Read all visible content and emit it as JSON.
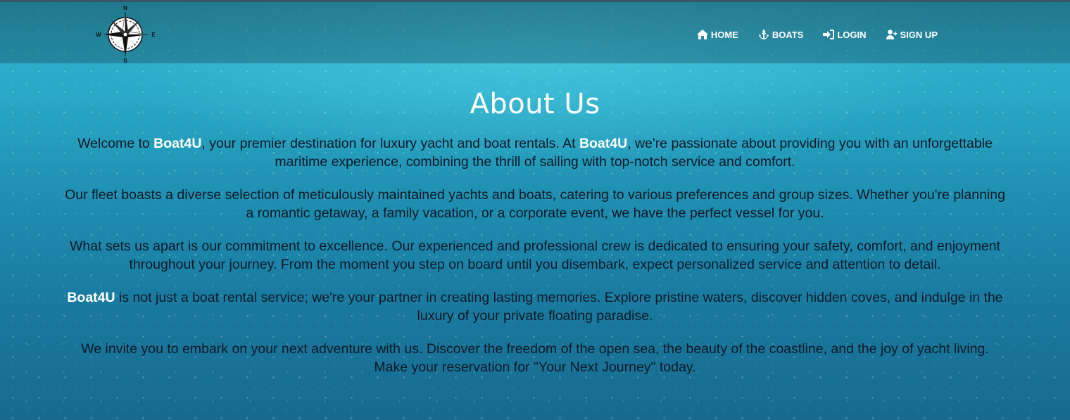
{
  "nav": {
    "logo": {
      "icon": "compass-rose-icon",
      "letters": [
        "N",
        "E",
        "S",
        "W"
      ]
    },
    "items": [
      {
        "label": "HOME",
        "icon": "home-icon"
      },
      {
        "label": "BOATS",
        "icon": "anchor-icon"
      },
      {
        "label": "LOGIN",
        "icon": "login-icon"
      },
      {
        "label": "SIGN UP",
        "icon": "user-plus-icon"
      }
    ]
  },
  "about": {
    "title": "About Us",
    "brand": "Boat4U",
    "p1": {
      "a": "Welcome to ",
      "b": ", your premier destination for luxury yacht and boat rentals. At ",
      "c": ", we're passionate about providing you with an unforgettable maritime experience, combining the thrill of sailing with top-notch service and comfort."
    },
    "p2": "Our fleet boasts a diverse selection of meticulously maintained yachts and boats, catering to various preferences and group sizes. Whether you're planning a romantic getaway, a family vacation, or a corporate event, we have the perfect vessel for you.",
    "p3": "What sets us apart is our commitment to excellence. Our experienced and professional crew is dedicated to ensuring your safety, comfort, and enjoyment throughout your journey. From the moment you step on board until you disembark, expect personalized service and attention to detail.",
    "p4": {
      "rest": " is not just a boat rental service; we're your partner in creating lasting memories. Explore pristine waters, discover hidden coves, and indulge in the luxury of your private floating paradise."
    },
    "p5": "We invite you to embark on your next adventure with us. Discover the freedom of the open sea, the beauty of the coastline, and the joy of yacht living. Make your reservation for \"Your Next Journey\" today."
  },
  "colors": {
    "water_top": "#2fb6cf",
    "water_bottom": "#186a8f",
    "text": "#0d1a24",
    "accent": "#ffffff"
  }
}
